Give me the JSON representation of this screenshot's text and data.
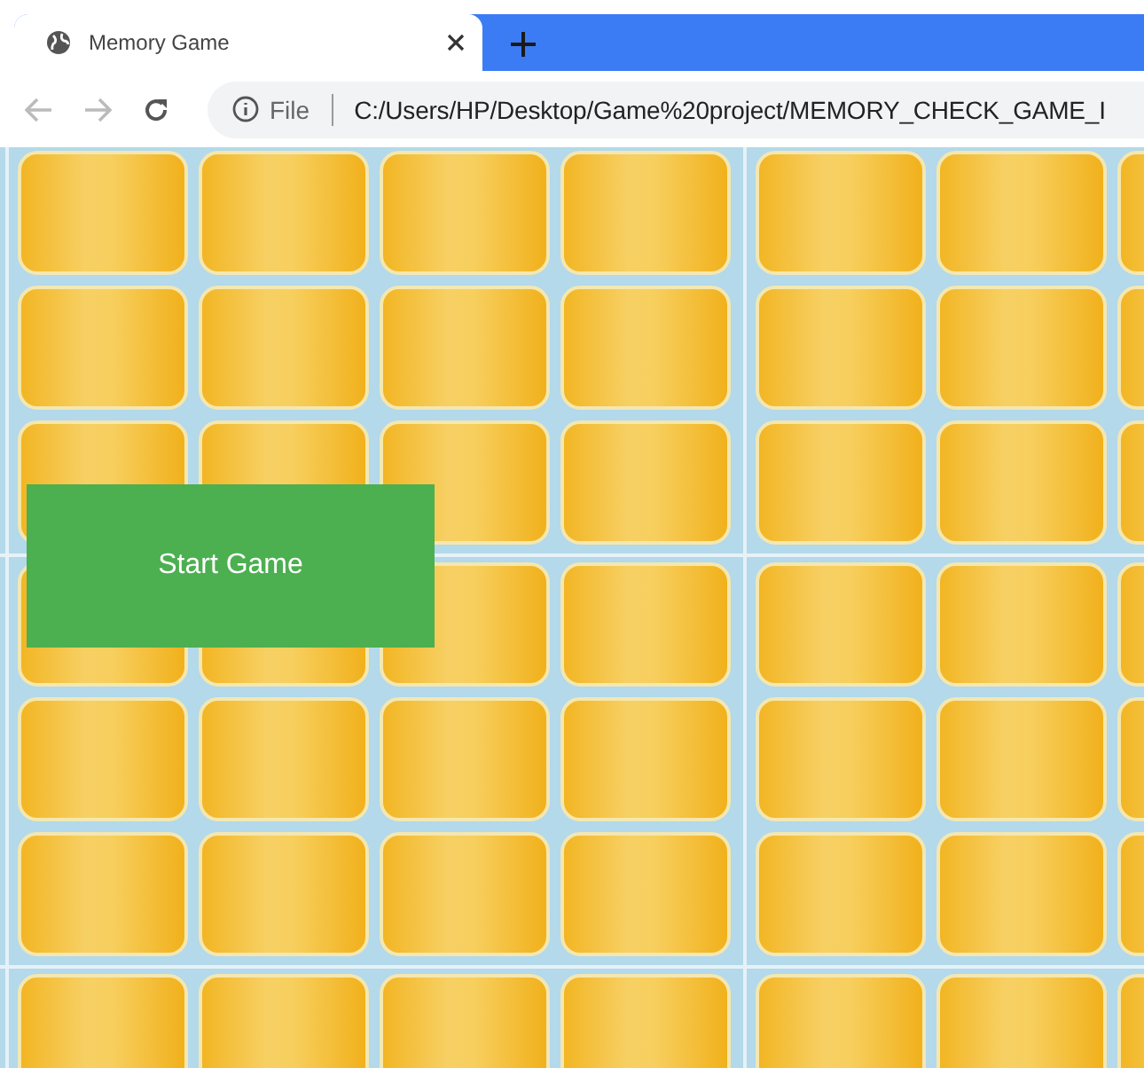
{
  "browser": {
    "tabs": [
      {
        "title": "Memory Game",
        "selected": true
      }
    ],
    "address_bar": {
      "scheme_label": "File",
      "url": "C:/Users/HP/Desktop/Game%20project/MEMORY_CHECK_GAME_I"
    }
  },
  "game": {
    "start_button": "Start Game"
  }
}
